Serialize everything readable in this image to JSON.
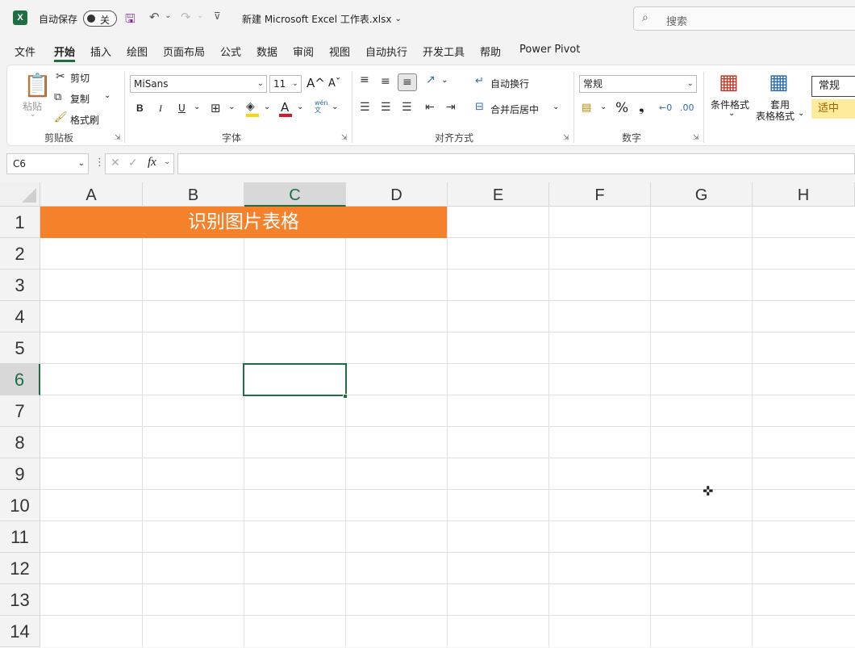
{
  "titlebar": {
    "autosave_label": "自动保存",
    "autosave_state": "关",
    "filename": "新建 Microsoft Excel 工作表.xlsx",
    "search_placeholder": "搜索",
    "app_logo_icon": "excel-logo-icon"
  },
  "menu": {
    "items": [
      "文件",
      "开始",
      "插入",
      "绘图",
      "页面布局",
      "公式",
      "数据",
      "审阅",
      "视图",
      "自动执行",
      "开发工具",
      "帮助",
      "Power Pivot"
    ],
    "active": "开始"
  },
  "ribbon": {
    "clipboard": {
      "paste": "粘贴",
      "cut": "剪切",
      "copy": "复制",
      "format_painter": "格式刷",
      "label": "剪贴板"
    },
    "font": {
      "name": "MiSans",
      "size": "11",
      "grow": "A^",
      "shrink": "Aˇ",
      "bold": "B",
      "italic": "I",
      "underline": "U",
      "wen": "wén\n文",
      "label": "字体"
    },
    "alignment": {
      "wrap": "自动换行",
      "merge": "合并后居中",
      "label": "对齐方式"
    },
    "number": {
      "format": "常规",
      "percent": "%",
      "comma": "❟",
      "label": "数字"
    },
    "styles": {
      "conditional": "条件格式",
      "table_line1": "套用",
      "table_line2": "表格格式",
      "normal": "常规",
      "neutral": "适中"
    },
    "colors": {
      "accent": "#1d6f42",
      "highlight_bar": "#ffd700",
      "font_color_bar": "#e81123",
      "neutral_bg": "#ffeb9c"
    }
  },
  "formula_bar": {
    "name_box": "C6",
    "formula": ""
  },
  "sheet": {
    "columns": [
      "A",
      "B",
      "C",
      "D",
      "E",
      "F",
      "G",
      "H"
    ],
    "rows": [
      "1",
      "2",
      "3",
      "4",
      "5",
      "6",
      "7",
      "8",
      "9",
      "10",
      "11",
      "12",
      "13",
      "14"
    ],
    "selected_column": "C",
    "selected_row": "6",
    "merged_text": "识别图片表格",
    "merged_bg": "#f5822a"
  }
}
